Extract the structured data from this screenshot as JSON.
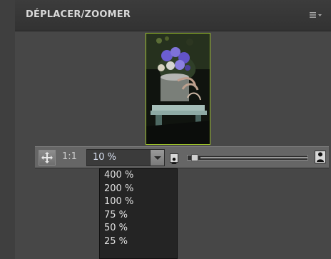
{
  "header": {
    "title": "DÉPLACER/ZOOMER",
    "menu_icon": "panel-menu-icon"
  },
  "toolbar": {
    "move_tool": "move-icon",
    "ratio_label": "1:1",
    "zoom_value": "10 %",
    "zoom_options": [
      "400 %",
      "200 %",
      "100 %",
      "75 %",
      "50 %",
      "25 %"
    ],
    "slider_fraction": 0.03
  },
  "colors": {
    "panel_bg": "#474747",
    "thumbnail_border": "#9bbf2a"
  }
}
